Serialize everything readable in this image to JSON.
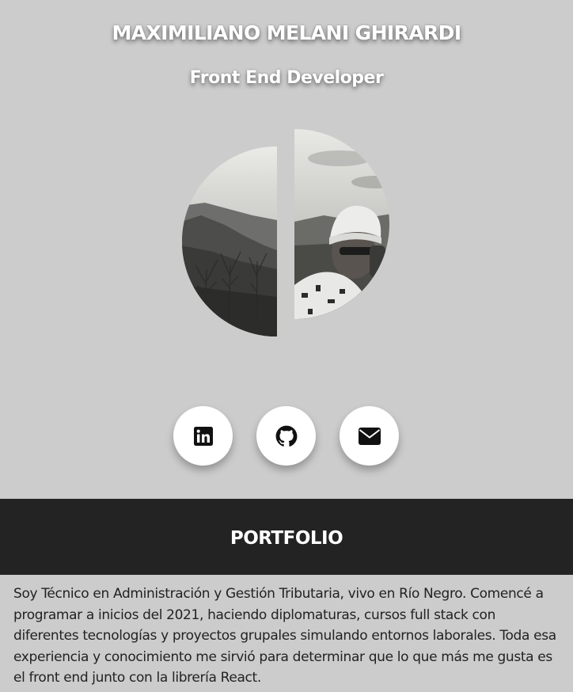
{
  "header": {
    "name": "MAXIMILIANO MELANI GHIRARDI",
    "role": "Front End Developer"
  },
  "portrait": {
    "alt": "Maximiliano Melani Ghirardi"
  },
  "socials": [
    {
      "icon": "linkedin-icon",
      "label": "LinkedIn"
    },
    {
      "icon": "github-icon",
      "label": "GitHub"
    },
    {
      "icon": "envelope-icon",
      "label": "Email"
    }
  ],
  "section": {
    "title": "PORTFOLIO"
  },
  "about": {
    "text": "Soy Técnico en Administración y Gestión Tributaria, vivo en Río Negro. Comencé a programar a inicios del 2021, haciendo diplomaturas, cursos full stack con diferentes tecnologías y proyectos grupales simulando entornos laborales. Toda esa experiencia y conocimiento me sirvió para determinar que lo que más me gusta es el front end junto con la librería React."
  },
  "colors": {
    "page_background": "#cccccc",
    "band_background": "#232323",
    "button_background": "#ffffff",
    "text_dark": "#222222",
    "text_light": "#ffffff"
  }
}
